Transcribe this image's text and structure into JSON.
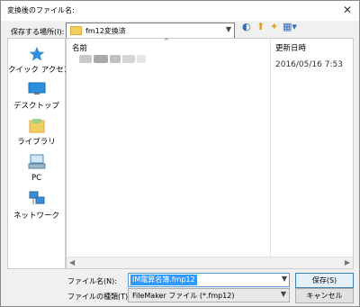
{
  "window": {
    "title": "変換後のファイル名:",
    "close_glyph": "✕"
  },
  "location": {
    "label": "保存する場所(I):",
    "value": "fm12変換済"
  },
  "toolbar": {
    "back_glyph": "◐",
    "up_glyph": "⬆",
    "new_folder_glyph": "✦",
    "view_glyph": "▦▾"
  },
  "places": [
    {
      "label": "クイック アクセス",
      "icon": "star-icon"
    },
    {
      "label": "デスクトップ",
      "icon": "desktop-icon"
    },
    {
      "label": "ライブラリ",
      "icon": "library-icon"
    },
    {
      "label": "PC",
      "icon": "pc-icon"
    },
    {
      "label": "ネットワーク",
      "icon": "network-icon"
    }
  ],
  "file_list": {
    "headers": {
      "name": "名前",
      "date": "更新日時"
    },
    "rows": [
      {
        "name": "",
        "date": "2016/05/16 7:53"
      }
    ]
  },
  "filename": {
    "label": "ファイル名(N):",
    "value": "IM電算名簿.fmp12"
  },
  "filetype": {
    "label": "ファイルの種類(T):",
    "value": "FileMaker ファイル (*.fmp12)"
  },
  "buttons": {
    "save": "保存(S)",
    "cancel": "キャンセル"
  },
  "colors": {
    "selection": "#3399ff",
    "folder": "#f3cf62",
    "primary_border": "#3c7fb1"
  }
}
